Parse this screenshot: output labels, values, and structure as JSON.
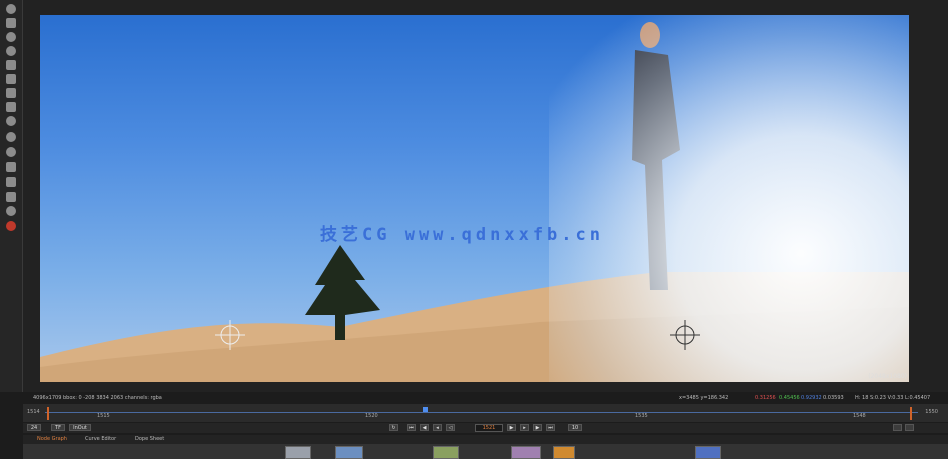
{
  "toolbar": {
    "tools": [
      "power-icon",
      "menu-icon",
      "circle-tool-icon",
      "blur-icon",
      "roto-icon",
      "layers-icon",
      "transform-icon",
      "3d-icon",
      "particles-icon",
      "info-icon",
      "eye-icon",
      "paint-icon",
      "brush-icon",
      "merge-icon",
      "color-icon",
      "record-icon"
    ]
  },
  "viewer": {
    "resolution_label": "(2048x1080)",
    "watermark": "技艺CG www.qdnxxfb.cn"
  },
  "info_bar": {
    "left": "4096x1709  bbox: 0 -208 3834 2063 channels: rgba",
    "coords": "x=3485 y=186.342",
    "r": "0.31256",
    "g": "0.45456",
    "b": "0.92932",
    "a": "0.03593",
    "right": "H: 18 S:0.23 V:0.33 L:0.45407"
  },
  "timeline": {
    "in_frame": "1514",
    "out_frame": "1550",
    "ticks": [
      "1515",
      "1520",
      "1535",
      "1548"
    ],
    "in_label": "1515",
    "out_label": "1548"
  },
  "transport": {
    "fps": "24",
    "mode": "TF",
    "range": "InOut",
    "current_frame": "1521",
    "step": "10"
  },
  "tabs": [
    {
      "label": "Node Graph",
      "active": true
    },
    {
      "label": "Curve Editor",
      "active": false
    },
    {
      "label": "Dope Sheet",
      "active": false
    }
  ],
  "colors": {
    "accent": "#e08040",
    "playhead": "#4f8ef0",
    "sky": "#4d8ce0"
  }
}
